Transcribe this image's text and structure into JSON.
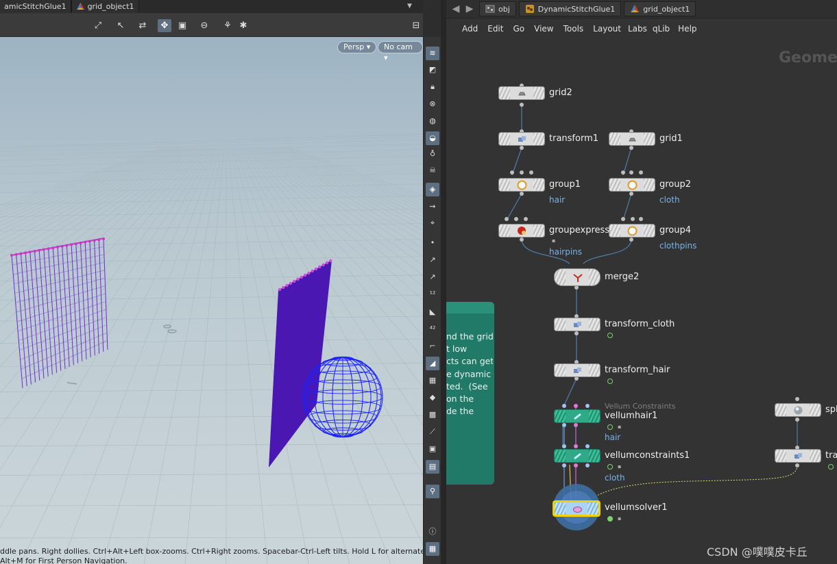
{
  "viewport": {
    "path_crumbs": [
      {
        "label": "amicStitchGlue1",
        "icon": "network-icon"
      },
      {
        "label": "grid_object1",
        "icon": "geometry-object-icon"
      }
    ],
    "camera_menu": "Persp ▾",
    "cam_menu": "No cam ▾",
    "status_line1": "ddle pans. Right dollies. Ctrl+Alt+Left box-zooms. Ctrl+Right zooms. Spacebar-Ctrl-Left tilts. Hold L for alternate tumble,",
    "status_line2": "Alt+M for First Person Navigation.",
    "colors": {
      "sky_top": "#9fb5c4",
      "ground": "#c7d3d8",
      "grid_lines": "#a9b8bf",
      "hair": "#6a2bd6",
      "cloth": "#4a18b0",
      "sphere": "#1a1aff"
    }
  },
  "network": {
    "nav": {
      "back": "◀",
      "forward": "▶"
    },
    "path_crumbs": [
      {
        "label": "obj",
        "icon": "obj-icon"
      },
      {
        "label": "DynamicStitchGlue1",
        "icon": "subnet-icon"
      },
      {
        "label": "grid_object1",
        "icon": "geometry-object-icon"
      }
    ],
    "menu": [
      "Add",
      "Edit",
      "Go",
      "View",
      "Tools",
      "Layout",
      "Labs",
      "qLib",
      "Help"
    ],
    "context_watermark": "Geomet",
    "sticky_note": "nd the grid\nt low\ncts can get\ne dynamic\nted.  (See\non the\nde the",
    "nodes": [
      {
        "name": "grid2"
      },
      {
        "name": "transform1"
      },
      {
        "name": "grid1"
      },
      {
        "name": "group1",
        "group": "hair"
      },
      {
        "name": "group2",
        "group": "cloth"
      },
      {
        "name": "groupexpressi",
        "group": "hairpins"
      },
      {
        "name": "group4",
        "group": "clothpins"
      },
      {
        "name": "merge2"
      },
      {
        "name": "transform_cloth"
      },
      {
        "name": "transform_hair"
      },
      {
        "name": "vellumhair1",
        "category": "Vellum Constraints",
        "group": "hair"
      },
      {
        "name": "vellumconstraints1",
        "group": "cloth"
      },
      {
        "name": "vellumsolver1"
      },
      {
        "name": "sph"
      },
      {
        "name": "tra"
      }
    ],
    "colors": {
      "wire": "#4f7fae",
      "teal_node": "#2fa986",
      "display_flag": "#f2d200",
      "group_text": "#78b4ea"
    }
  },
  "watermark": "CSDN @噗噗皮卡丘"
}
